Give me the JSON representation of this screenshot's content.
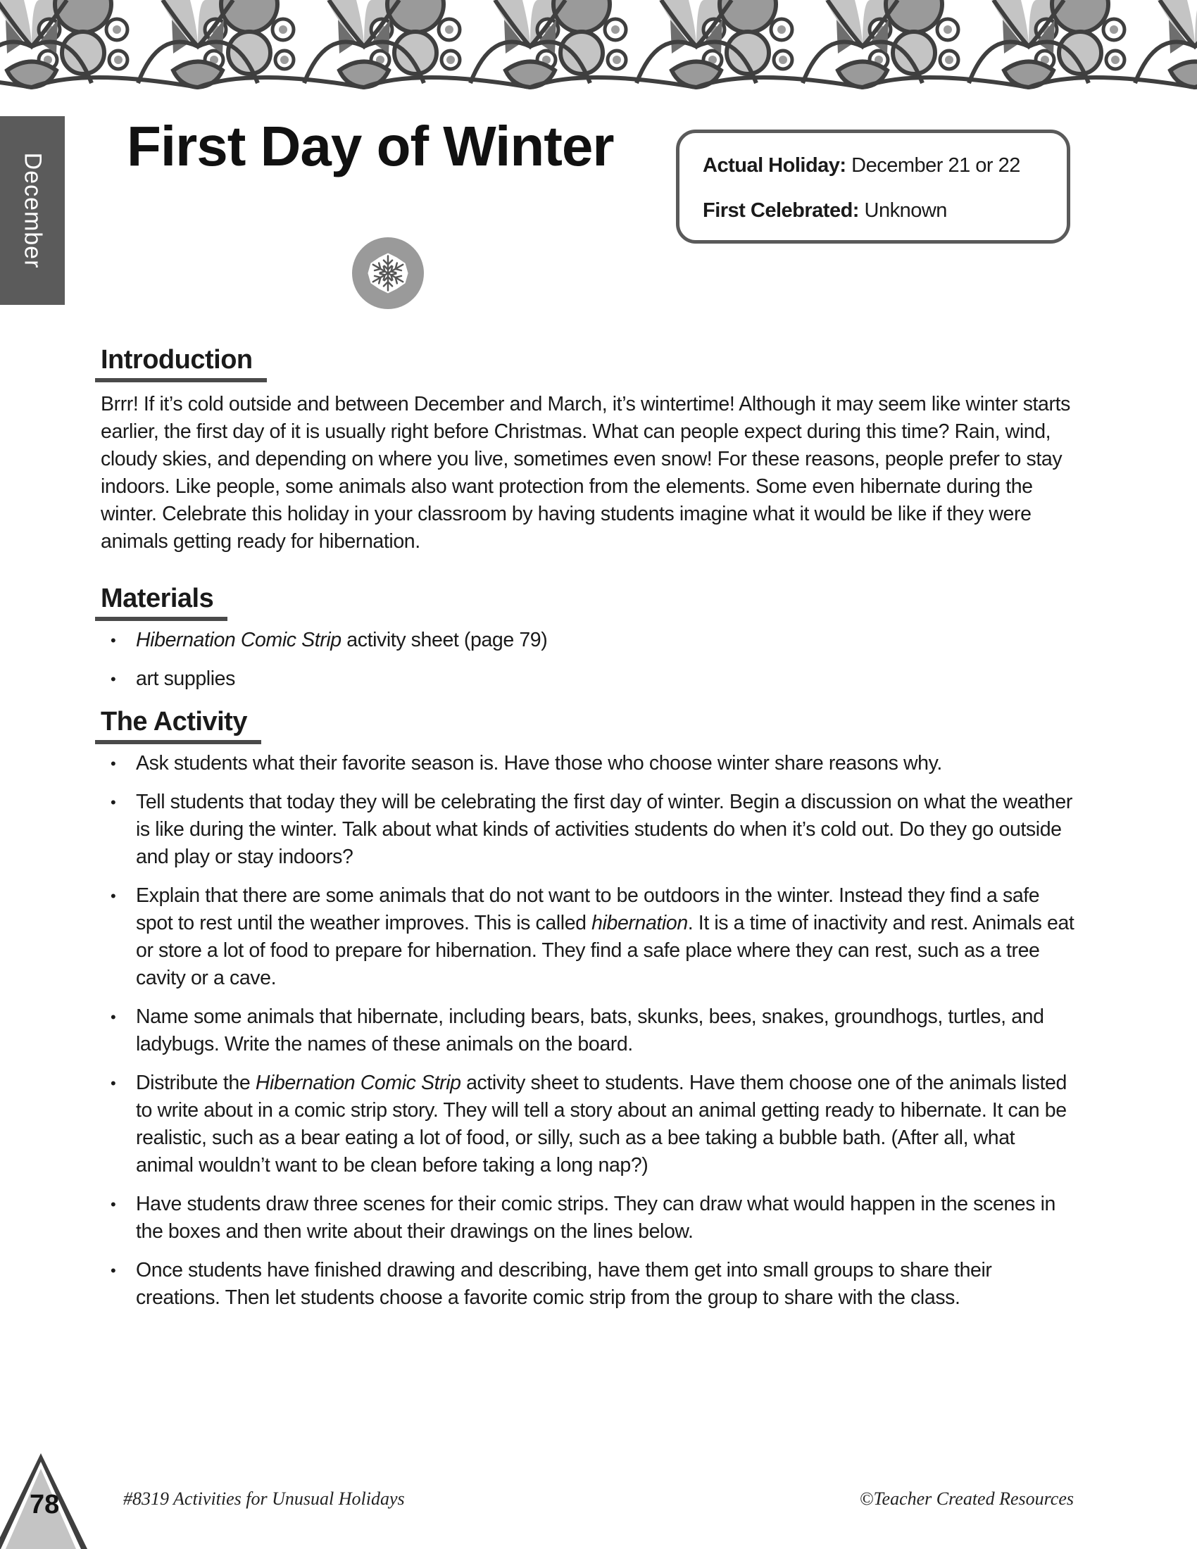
{
  "colors": {
    "tab": "#5b5b5b",
    "outline": "#3f3f3f",
    "light_gray": "#c4c4c4",
    "mid_gray": "#9a9a9a",
    "dark_gray": "#6e6e6e"
  },
  "month_tab": {
    "label": "December"
  },
  "header": {
    "title": "First Day of Winter",
    "icon": "snowflake-icon"
  },
  "info_box": {
    "actual_holiday_label": "Actual Holiday:",
    "actual_holiday_value": "December 21 or 22",
    "first_celebrated_label": "First Celebrated:",
    "first_celebrated_value": "Unknown"
  },
  "introduction": {
    "heading": "Introduction",
    "text": "Brrr! If it’s cold outside and between December and March, it’s wintertime! Although it may seem like winter starts earlier, the first day of it is usually right before Christmas. What can people expect during this time? Rain, wind, cloudy skies, and depending on where you live, sometimes even snow! For these reasons, people prefer to stay indoors. Like people, some animals also want protection from the elements. Some even hibernate during the winter. Celebrate this holiday in your classroom by having students imagine what it would be like if they were animals getting ready for hibernation."
  },
  "materials": {
    "heading": "Materials",
    "items": [
      {
        "italic": "Hibernation Comic Strip",
        "text": " activity sheet (page 79)"
      },
      {
        "italic": "",
        "text": "art supplies"
      }
    ]
  },
  "activity": {
    "heading": "The Activity",
    "items": [
      {
        "pre": "Ask students what their favorite season is. Have those who choose winter share reasons why.",
        "italic": "",
        "post": ""
      },
      {
        "pre": "Tell students that today they will be celebrating the first day of winter. Begin a discussion on what the weather is like during the winter. Talk about what kinds of activities students do when it’s cold out. Do they go outside and play or stay indoors?",
        "italic": "",
        "post": ""
      },
      {
        "pre": "Explain that there are some animals that do not want to be outdoors in the winter. Instead they find a safe spot to rest until the weather improves. This is called ",
        "italic": "hibernation",
        "post": ". It is a time of inactivity and rest. Animals eat or store a lot of food to prepare for hibernation. They find a safe place where they can rest, such as a tree cavity or a cave."
      },
      {
        "pre": "Name some animals that hibernate, including bears, bats, skunks, bees, snakes, groundhogs, turtles, and ladybugs. Write the names of these animals on the board.",
        "italic": "",
        "post": ""
      },
      {
        "pre": "Distribute the ",
        "italic": "Hibernation Comic Strip",
        "post": " activity sheet to students. Have them choose one of the animals listed to write about in a comic strip story. They will tell a story about an animal getting ready to hibernate. It can be realistic, such as a bear eating a lot of food, or silly, such as a bee taking a bubble bath. (After all, what animal wouldn’t want to be clean before taking a long nap?)"
      },
      {
        "pre": "Have students draw three scenes for their comic strips. They can draw what would happen in the scenes in the boxes and then write about their drawings on the lines below.",
        "italic": "",
        "post": ""
      },
      {
        "pre": "Once students have finished drawing and describing, have them get into small groups to share their creations. Then let students choose a favorite comic strip from the group to share with the class.",
        "italic": "",
        "post": ""
      }
    ]
  },
  "footer": {
    "page_number": "78",
    "book_title": "#8319 Activities for Unusual Holidays",
    "copyright": "©Teacher Created Resources"
  }
}
